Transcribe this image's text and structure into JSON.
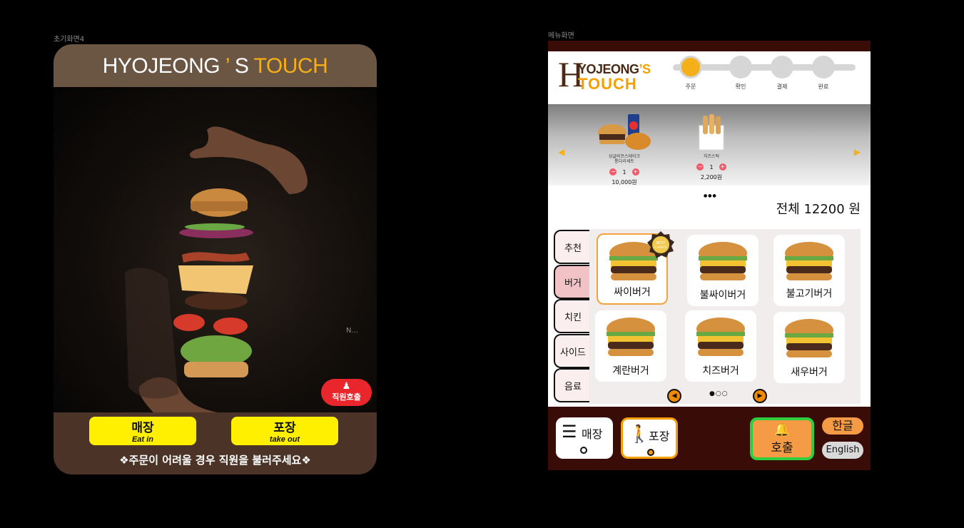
{
  "frames": {
    "start_label": "초기화면4",
    "menu_label": "메뉴화면"
  },
  "start": {
    "logo_main": "HYOJEONG",
    "logo_apo": "’",
    "logo_s": "S",
    "logo_accent": "TOUCH",
    "hidden_label": "N...",
    "staff_call": "직원호출",
    "eat_in_ko": "매장",
    "eat_in_en": "Eat in",
    "takeout_ko": "포장",
    "takeout_en": "take out",
    "notice": "❖주문이 어려울 경우 직원을 불러주세요❖"
  },
  "menu": {
    "logo_h": "H",
    "logo_line1": "YOJEONG",
    "logo_apo": "’S",
    "logo_line2": "TOUCH",
    "steps": [
      "주문",
      "확인",
      "결제",
      "완료"
    ],
    "active_step": 0,
    "cart": [
      {
        "name_l1": "싱글비프스테이크",
        "name_l2": "통다리세트",
        "qty": "1",
        "price": "10,000원"
      },
      {
        "name_l1": "치즈스틱",
        "name_l2": "",
        "qty": "1",
        "price": "2,200원"
      }
    ],
    "cart_pager": "●●●",
    "total": "전체 12200 원",
    "categories": [
      "추천",
      "버거",
      "치킨",
      "사이드",
      "음료"
    ],
    "active_category": 1,
    "items": [
      "싸이버거",
      "불싸이버거",
      "불고기버거",
      "계란버거",
      "치즈버거",
      "새우버거"
    ],
    "badge_text_1": "BEST",
    "badge_text_2": "CHOICE",
    "item_pager": "●○○",
    "footer": {
      "eat_in": "매장",
      "takeout": "포장",
      "call": "호출",
      "lang_ko": "한글",
      "lang_en": "English"
    },
    "colors": {
      "accent": "#f5b019",
      "bar": "#3a0c08",
      "call_border": "#2fce3f"
    }
  }
}
